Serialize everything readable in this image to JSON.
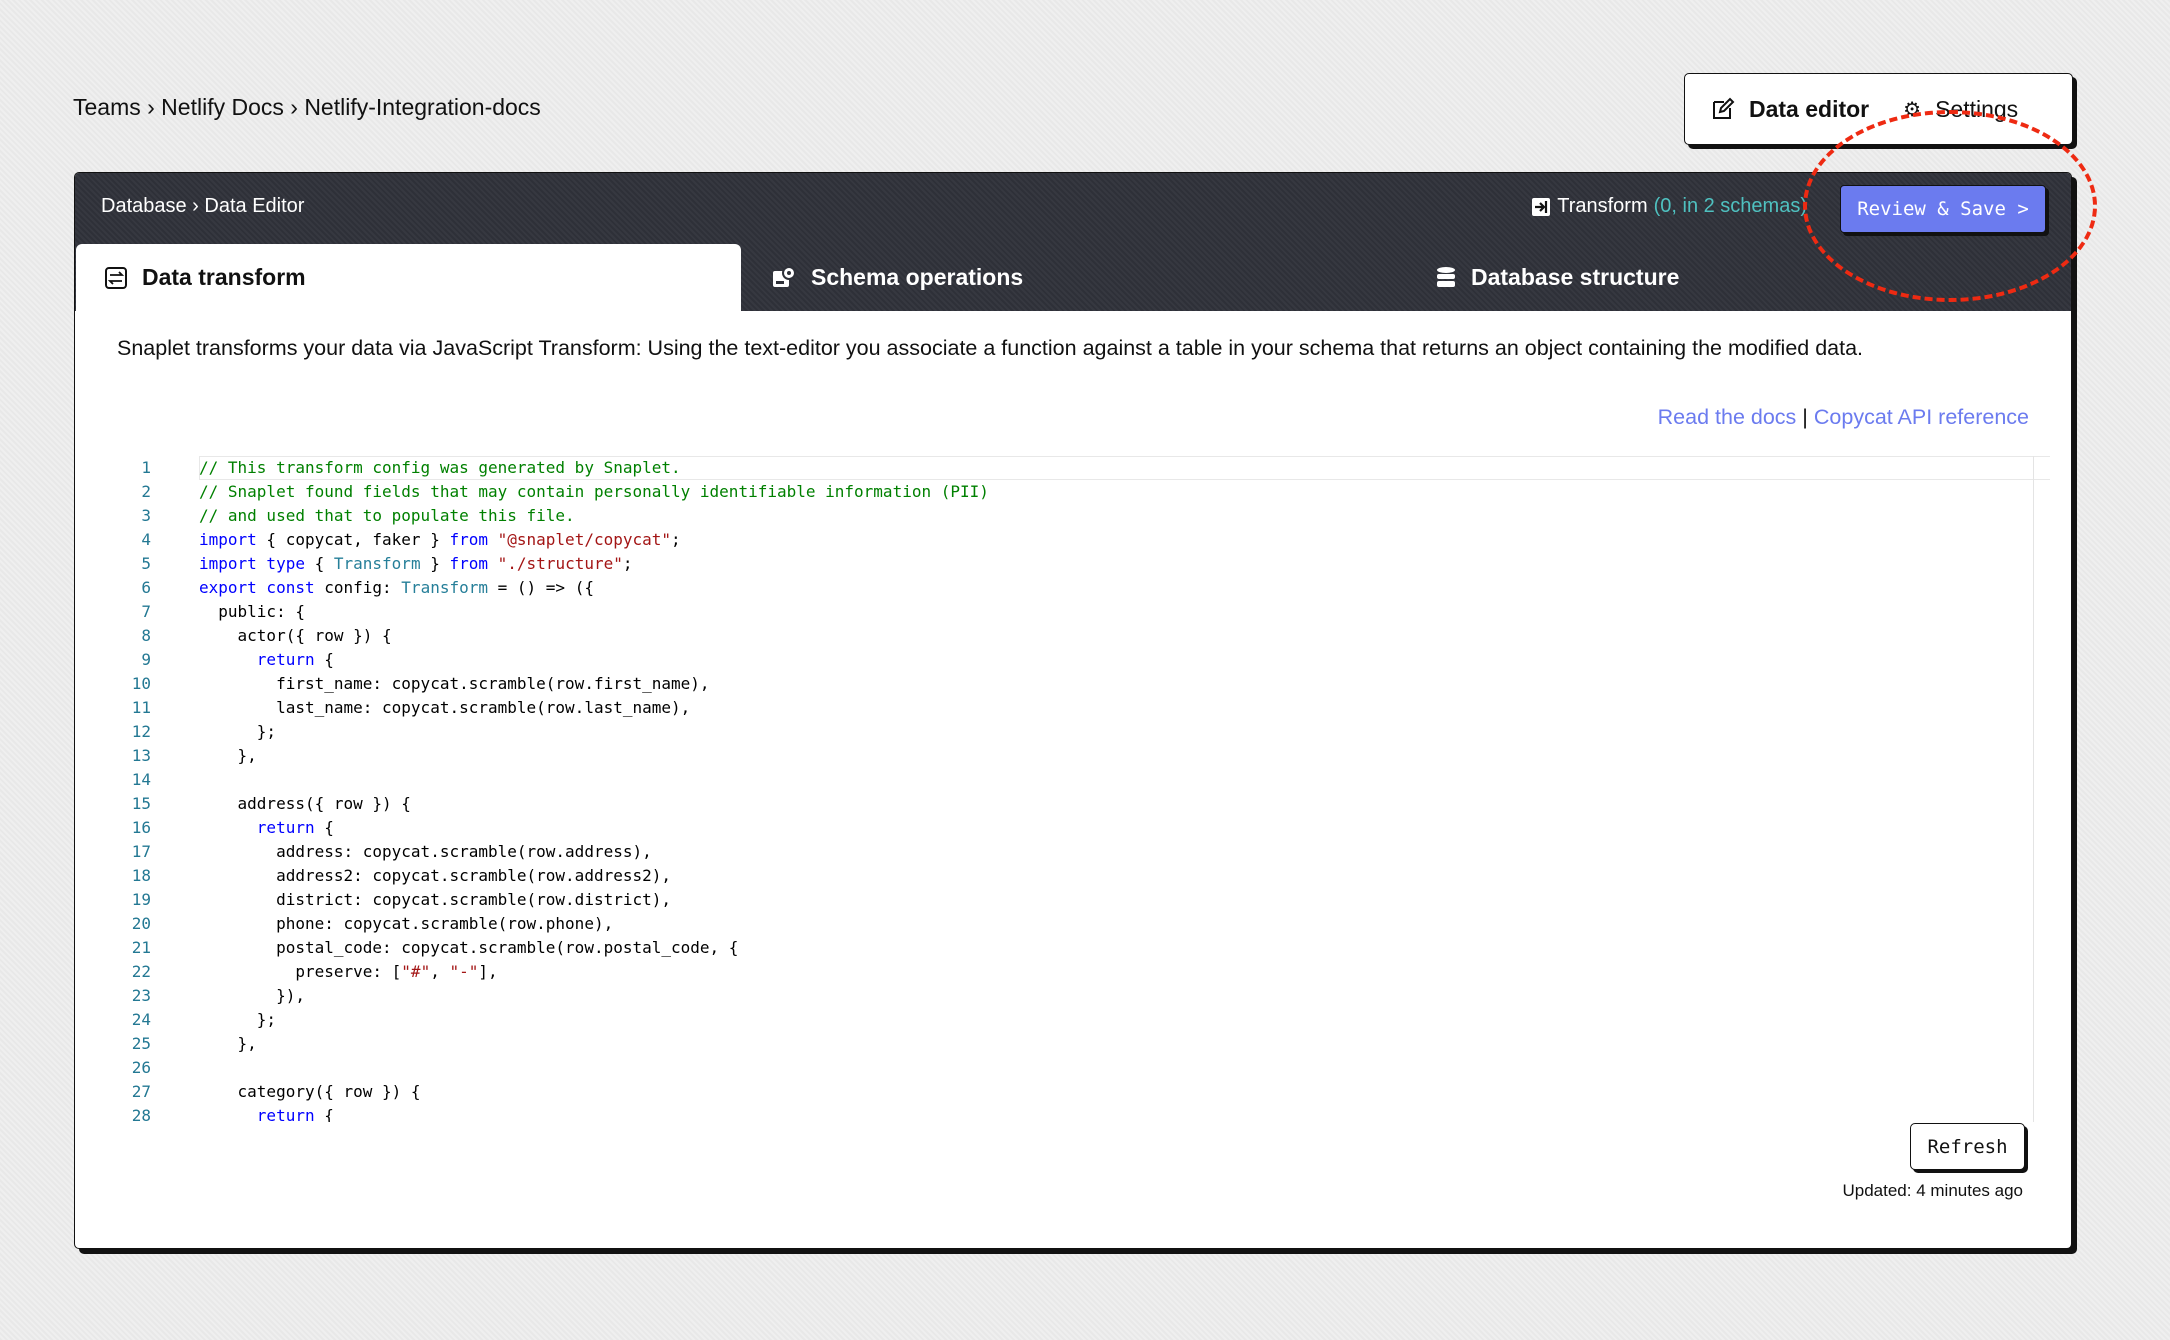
{
  "breadcrumb": "Teams › Netlify Docs › Netlify-Integration-docs",
  "top_nav": {
    "data_editor": "Data editor",
    "settings": "Settings"
  },
  "header": {
    "breadcrumb": "Database › Data Editor",
    "transform_label": "Transform",
    "transform_count": "(0, in 2 schemas)",
    "review_save": "Review & Save >"
  },
  "tabs": [
    {
      "label": "Data transform",
      "active": true
    },
    {
      "label": "Schema operations"
    },
    {
      "label": "Database structure"
    }
  ],
  "description": "Snaplet transforms your data via JavaScript Transform: Using the text-editor you associate a function against a table in your schema that returns an object containing the modified data.",
  "links": {
    "docs": "Read the docs",
    "separator": "|",
    "api": "Copycat API reference"
  },
  "code_lines": [
    [
      [
        "c",
        "// This transform config was generated by Snaplet."
      ]
    ],
    [
      [
        "c",
        "// Snaplet found fields that may contain personally identifiable information (PII)"
      ]
    ],
    [
      [
        "c",
        "// and used that to populate this file."
      ]
    ],
    [
      [
        "k",
        "import"
      ],
      [
        "p",
        " { copycat, faker } "
      ],
      [
        "k",
        "from"
      ],
      [
        "p",
        " "
      ],
      [
        "s",
        "\"@snaplet/copycat\""
      ],
      [
        "p",
        ";"
      ]
    ],
    [
      [
        "k",
        "import type"
      ],
      [
        "p",
        " { "
      ],
      [
        "t",
        "Transform"
      ],
      [
        "p",
        " } "
      ],
      [
        "k",
        "from"
      ],
      [
        "p",
        " "
      ],
      [
        "s",
        "\"./structure\""
      ],
      [
        "p",
        ";"
      ]
    ],
    [
      [
        "k",
        "export const"
      ],
      [
        "p",
        " config: "
      ],
      [
        "t",
        "Transform"
      ],
      [
        "p",
        " = () => ({"
      ]
    ],
    [
      [
        "p",
        "  public: {"
      ]
    ],
    [
      [
        "p",
        "    actor({ row }) {"
      ]
    ],
    [
      [
        "p",
        "      "
      ],
      [
        "k",
        "return"
      ],
      [
        "p",
        " {"
      ]
    ],
    [
      [
        "p",
        "        first_name: copycat.scramble(row.first_name),"
      ]
    ],
    [
      [
        "p",
        "        last_name: copycat.scramble(row.last_name),"
      ]
    ],
    [
      [
        "p",
        "      };"
      ]
    ],
    [
      [
        "p",
        "    },"
      ]
    ],
    [
      [
        "p",
        ""
      ]
    ],
    [
      [
        "p",
        "    address({ row }) {"
      ]
    ],
    [
      [
        "p",
        "      "
      ],
      [
        "k",
        "return"
      ],
      [
        "p",
        " {"
      ]
    ],
    [
      [
        "p",
        "        address: copycat.scramble(row.address),"
      ]
    ],
    [
      [
        "p",
        "        address2: copycat.scramble(row.address2),"
      ]
    ],
    [
      [
        "p",
        "        district: copycat.scramble(row.district),"
      ]
    ],
    [
      [
        "p",
        "        phone: copycat.scramble(row.phone),"
      ]
    ],
    [
      [
        "p",
        "        postal_code: copycat.scramble(row.postal_code, {"
      ]
    ],
    [
      [
        "p",
        "          preserve: ["
      ],
      [
        "s",
        "\"#\""
      ],
      [
        "p",
        ", "
      ],
      [
        "s",
        "\"-\""
      ],
      [
        "p",
        "],"
      ]
    ],
    [
      [
        "p",
        "        }),"
      ]
    ],
    [
      [
        "p",
        "      };"
      ]
    ],
    [
      [
        "p",
        "    },"
      ]
    ],
    [
      [
        "p",
        ""
      ]
    ],
    [
      [
        "p",
        "    category({ row }) {"
      ]
    ],
    [
      [
        "p",
        "      "
      ],
      [
        "k",
        "return"
      ],
      [
        "p",
        " {"
      ]
    ]
  ],
  "refresh": "Refresh",
  "updated": "Updated: 4 minutes ago",
  "colors": {
    "accent": "#6b7bef",
    "header_bg": "#2e3038",
    "highlight_ring": "#ee2a12",
    "count": "#4fc1c0"
  },
  "icons": {
    "data_editor": "pencil-square-icon",
    "settings": "gear-icon",
    "transform": "arrow-into-box-icon",
    "data_transform": "swap-arrows-icon",
    "schema_operations": "robot-gear-icon",
    "database_structure": "database-icon"
  }
}
